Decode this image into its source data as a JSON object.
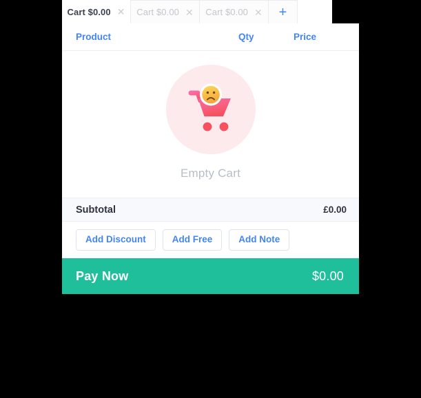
{
  "tab_bar": {
    "tabs": [
      {
        "label": "Cart $0.00",
        "close_icon": "✕",
        "active": true
      },
      {
        "label": "Cart $0.00",
        "close_icon": "✕",
        "active": false
      },
      {
        "label": "Cart $0.00",
        "close_icon": "✕",
        "active": false
      }
    ],
    "add_tab_label": "+"
  },
  "cart": {
    "columns": {
      "product": "Product",
      "qty": "Qty",
      "price": "Price"
    },
    "empty_state": {
      "message": "Empty Cart",
      "icon": "empty-cart-illustration"
    },
    "subtotal": {
      "label": "Subtotal",
      "value": "£0.00"
    },
    "actions": [
      {
        "label": "Add Discount"
      },
      {
        "label": "Add Free"
      },
      {
        "label": "Add Note"
      }
    ],
    "pay_now": {
      "label": "Pay Now",
      "amount": "$0.00"
    }
  },
  "colors": {
    "accent_blue": "#4285f4",
    "pay_green": "#1fbf9c",
    "illustration_bg": "#fdeaec",
    "cart_pink": "#f86b8e",
    "face_yellow": "#fbc74b",
    "subtotal_bg": "#f8f9fd",
    "page_background": "#000000"
  }
}
